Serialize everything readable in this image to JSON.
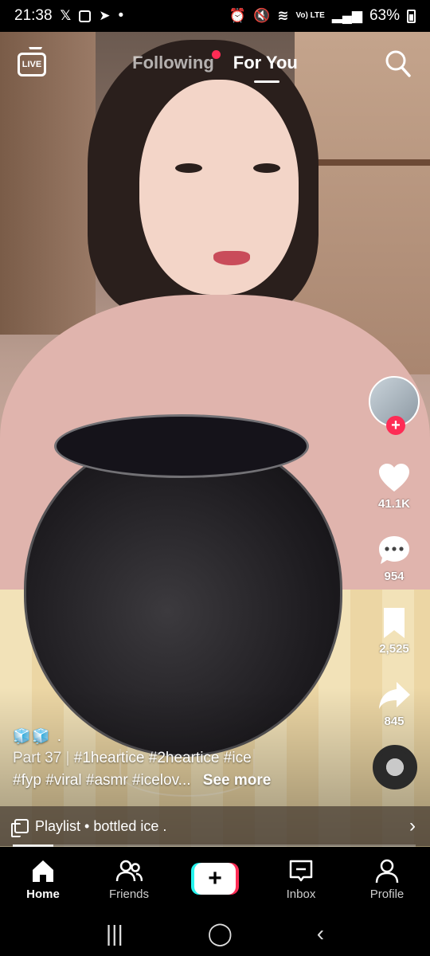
{
  "status_bar": {
    "time": "21:38",
    "left_icons": [
      "x-icon",
      "notification-box-icon",
      "telegram-icon",
      "dot-icon"
    ],
    "network": "Vo) LTE",
    "battery": "63%"
  },
  "top_nav": {
    "live_label": "LIVE",
    "following_label": "Following",
    "foryou_label": "For You"
  },
  "actions": {
    "likes": "41.1K",
    "comments": "954",
    "saves": "2,525",
    "shares": "845"
  },
  "caption": {
    "emoji": "🧊🧊 .",
    "part": "Part 37",
    "separator": "|",
    "hashtags_line1": "#1heartice #2heartice #ice",
    "hashtags_line2": "#fyp #viral #asmr #icelov...",
    "see_more": "See more"
  },
  "playlist": {
    "label": "Playlist • bottled ice ."
  },
  "progress": 0.1,
  "bottom_nav": {
    "home": "Home",
    "friends": "Friends",
    "inbox": "Inbox",
    "profile": "Profile"
  },
  "colors": {
    "accent": "#fe2c55",
    "cyan": "#25f4ee"
  }
}
